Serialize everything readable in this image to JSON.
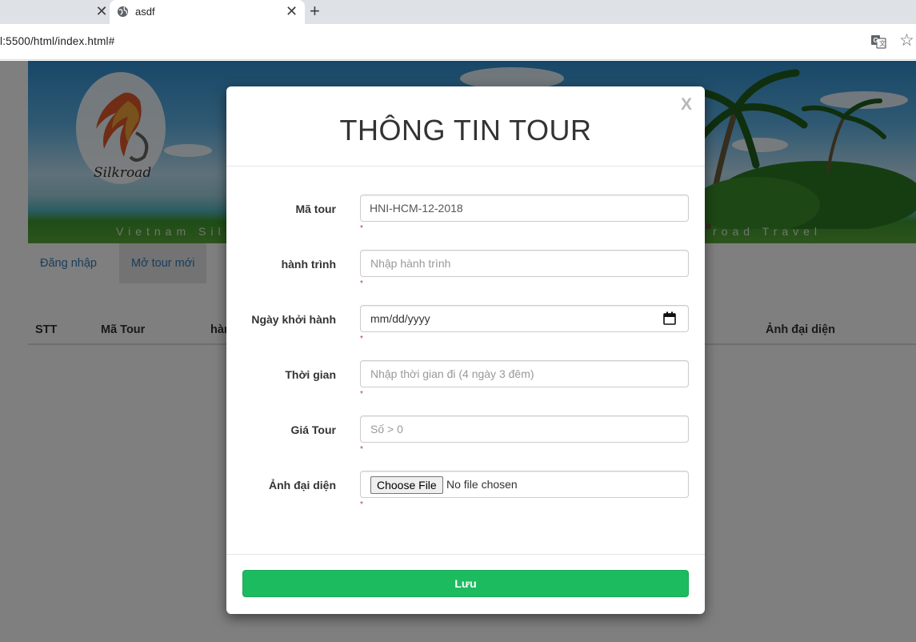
{
  "browser": {
    "prev_tab_close": "✕",
    "tab_title": "asdf",
    "tab_close": "✕",
    "new_tab": "+",
    "url": "l:5500/html/index.html#"
  },
  "page": {
    "banner": {
      "logo_text": "Silkroad",
      "tagline_left": "Vietnam Sil",
      "tagline_right": "road Travel"
    },
    "nav": {
      "login": "Đăng nhập",
      "new_tour": "Mở tour mới"
    },
    "table": {
      "headers": [
        "STT",
        "Mã Tour",
        "hàn",
        "Ảnh đại diện"
      ]
    }
  },
  "modal": {
    "close": "X",
    "title": "THÔNG TIN TOUR",
    "fields": {
      "ma_tour": {
        "label": "Mã tour",
        "value": "HNI-HCM-12-2018",
        "required": "*"
      },
      "hanh_trinh": {
        "label": "hành trình",
        "placeholder": "Nhập hành trình",
        "required": "*"
      },
      "ngay_khoi_hanh": {
        "label": "Ngày khởi hành",
        "value": "mm/dd/yyyy",
        "required": "*"
      },
      "thoi_gian": {
        "label": "Thời gian",
        "placeholder": "Nhập thời gian đi (4 ngày 3 đêm)",
        "required": "*"
      },
      "gia_tour": {
        "label": "Giá Tour",
        "placeholder": "Số > 0",
        "required": "*"
      },
      "anh_dai_dien": {
        "label": "Ảnh đại diện",
        "button": "Choose File",
        "status": "No file chosen",
        "required": "*"
      }
    },
    "save_label": "Lưu"
  },
  "colors": {
    "save_button": "#1dbb5f",
    "link": "#337ab7",
    "required_mark": "#a94442"
  }
}
